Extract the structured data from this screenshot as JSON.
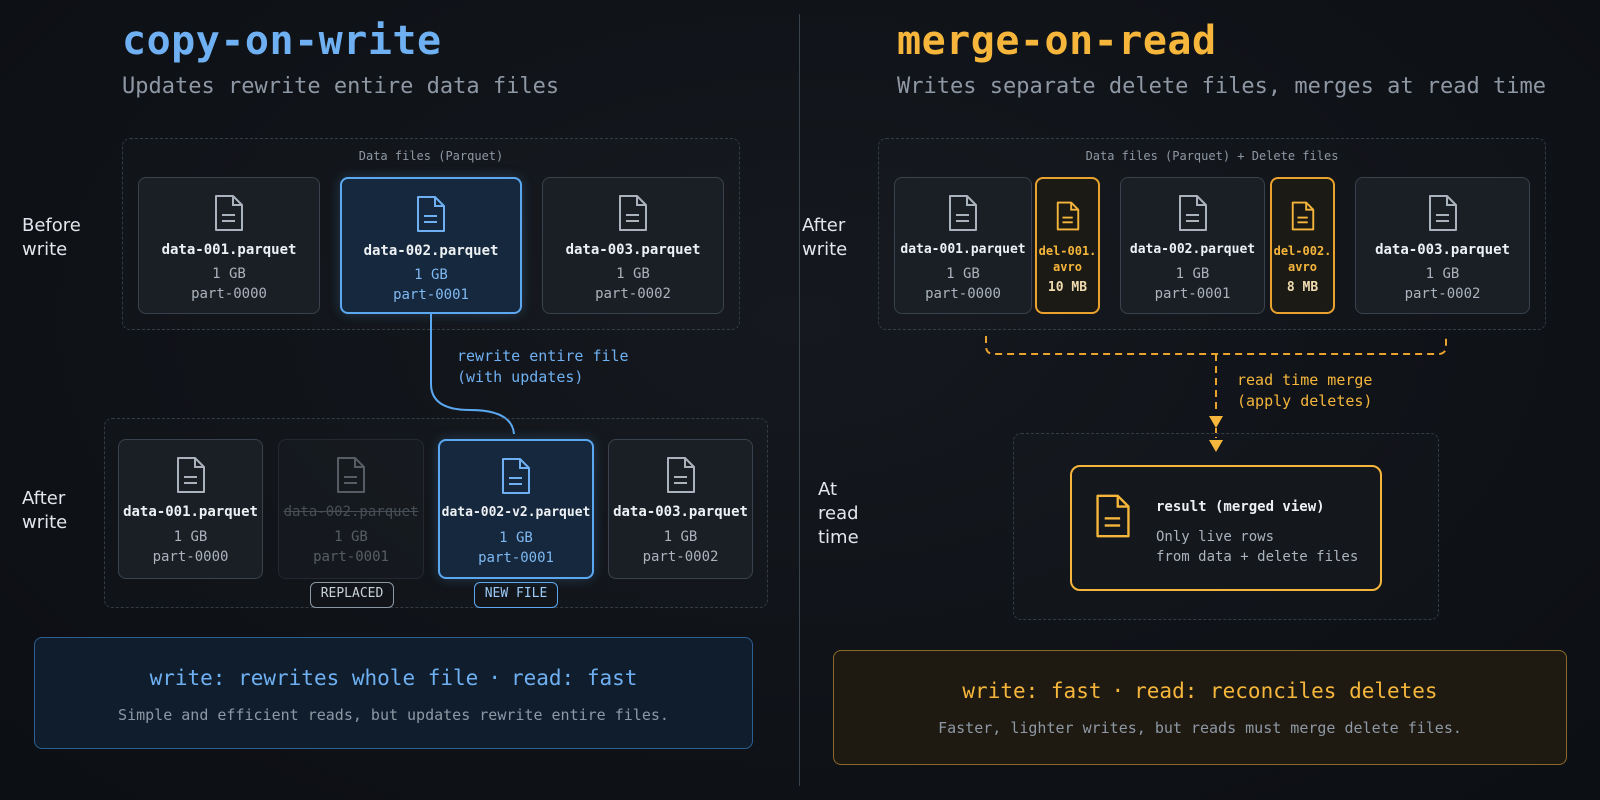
{
  "left": {
    "title": "copy-on-write",
    "subtitle": "Updates rewrite entire data files",
    "group_label": "Data files (Parquet)",
    "before_label": "Before\nwrite",
    "after_label": "After\nwrite",
    "before_files": [
      {
        "name": "data-001.parquet",
        "size": "1 GB",
        "part": "part-0000"
      },
      {
        "name": "data-002.parquet",
        "size": "1 GB",
        "part": "part-0001"
      },
      {
        "name": "data-003.parquet",
        "size": "1 GB",
        "part": "part-0002"
      }
    ],
    "after_files": [
      {
        "name": "data-001.parquet",
        "size": "1 GB",
        "part": "part-0000"
      },
      {
        "name": "data-002.parquet",
        "size": "1 GB",
        "part": "part-0001"
      },
      {
        "name": "data-002-v2.parquet",
        "size": "1 GB",
        "part": "part-0001"
      },
      {
        "name": "data-003.parquet",
        "size": "1 GB",
        "part": "part-0002"
      }
    ],
    "arrow_label_1": "rewrite entire file",
    "arrow_label_2": "(with updates)",
    "replaced_tag": "REPLACED",
    "new_tag": "NEW FILE",
    "summary_write": "write: rewrites whole file",
    "summary_sep": "·",
    "summary_read": "read: fast",
    "summary_body": "Simple and efficient reads, but updates rewrite entire files."
  },
  "right": {
    "title": "merge-on-read",
    "subtitle": "Writes separate delete files, merges at read time",
    "group_label": "Data files (Parquet) + Delete files",
    "after_label": "After\nwrite",
    "read_label": "At\nread\ntime",
    "data_files": [
      {
        "name": "data-001.parquet",
        "size": "1 GB",
        "part": "part-0000"
      },
      {
        "name": "data-002.parquet",
        "size": "1 GB",
        "part": "part-0001"
      },
      {
        "name": "data-003.parquet",
        "size": "1 GB",
        "part": "part-0002"
      }
    ],
    "delete_files": [
      {
        "name_1": "del-001.",
        "name_2": "avro",
        "size": "10 MB"
      },
      {
        "name_1": "del-002.",
        "name_2": "avro",
        "size": "8 MB"
      }
    ],
    "merge_label_1": "read time merge",
    "merge_label_2": "(apply deletes)",
    "result_title": "result (merged view)",
    "result_desc_1": "Only live rows",
    "result_desc_2": "from data + delete files",
    "summary_write": "write: fast",
    "summary_sep": "·",
    "summary_read": "read: reconciles deletes",
    "summary_body": "Faster, lighter writes, but reads must merge delete files."
  },
  "colors": {
    "blue_accent": "#6fb0f2",
    "orange_accent": "#f5b63b",
    "background": "#0f1217"
  },
  "icons": {
    "file": "document-icon"
  }
}
